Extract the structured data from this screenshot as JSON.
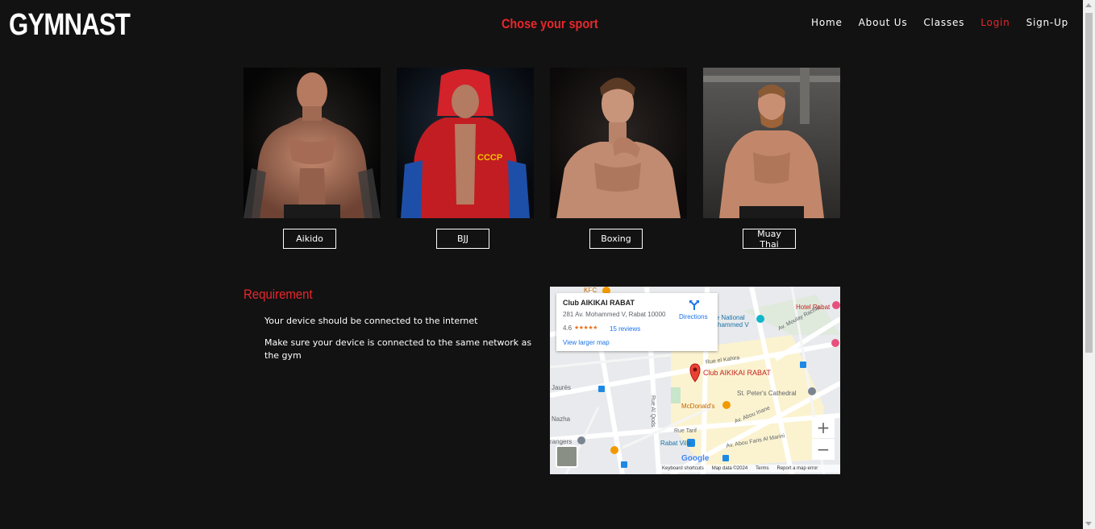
{
  "header": {
    "logo": "GYMNAST",
    "tagline": "Chose your sport",
    "nav": [
      {
        "label": "Home",
        "active": false
      },
      {
        "label": "About Us",
        "active": false
      },
      {
        "label": "Classes",
        "active": false
      },
      {
        "label": "Login",
        "active": true
      },
      {
        "label": "Sign-Up",
        "active": false
      }
    ]
  },
  "sports": [
    {
      "label": "Aikido"
    },
    {
      "label": "BJJ"
    },
    {
      "label": "Boxing"
    },
    {
      "label": "Muay Thai"
    }
  ],
  "requirement": {
    "title": "Requirement",
    "items": [
      "Your device should be connected to the internet",
      "Make sure your device is connected to the same network as the gym"
    ]
  },
  "map": {
    "place_name": "Club AIKIKAI RABAT",
    "address": "281 Av. Mohammed V, Rabat 10000",
    "rating": "4.6",
    "stars": "★★★★★",
    "reviews": "15 reviews",
    "larger_map": "View larger map",
    "directions": "Directions",
    "pin_label": "Club AIKIKAI RABAT",
    "zoom_in": "+",
    "zoom_out": "−",
    "footer": [
      "Keyboard shortcuts",
      "Map data ©2024",
      "Terms",
      "Report a map error"
    ],
    "labels": {
      "hotel": "Hotel Rabat",
      "national": "re National",
      "mohammed": "hammed V",
      "moulay": "Av. Moulay Rachid",
      "kahira": "Rue el Kahira",
      "peters": "St. Peter's Cathedral",
      "mcdonalds": "McDonald's",
      "jaures": "Jaurès",
      "alqods": "Rue Al Qods",
      "nazha": "Nazha",
      "tarif": "Rue Tarif",
      "rabatville": "Rabat Ville",
      "abouinane": "Av. Abou Inane",
      "aboufaris": "Av. Abou Faris Al Marini",
      "angers": "rangers",
      "kfc": "KFC",
      "google": "Google"
    },
    "colors": {
      "pin": "#ea4335",
      "link": "#1a73e8",
      "food": "#f29900",
      "poi": "#1e88e5"
    }
  },
  "theme": {
    "background": "#121212",
    "accent": "#e8272c"
  }
}
